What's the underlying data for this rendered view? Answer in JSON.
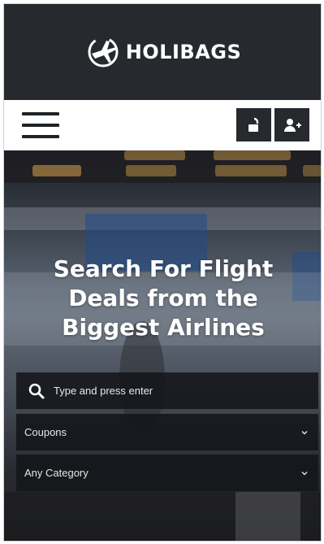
{
  "header": {
    "logo_text": "HOLIBAGS"
  },
  "navbar": {
    "menu_icon": "hamburger-icon",
    "login_icon": "unlock-icon",
    "register_icon": "add-user-icon"
  },
  "hero": {
    "title_line1": "Search For Flight",
    "title_line2": "Deals from the",
    "title_line3": "Biggest Airlines"
  },
  "search": {
    "placeholder": "Type and press enter",
    "icon": "search-icon"
  },
  "filters": {
    "coupons_label": "Coupons",
    "category_label": "Any Category"
  },
  "colors": {
    "header_bg": "#262a2e",
    "button_bg": "#262a2e",
    "field_bg": "#16181c",
    "text_light": "#ffffff"
  }
}
